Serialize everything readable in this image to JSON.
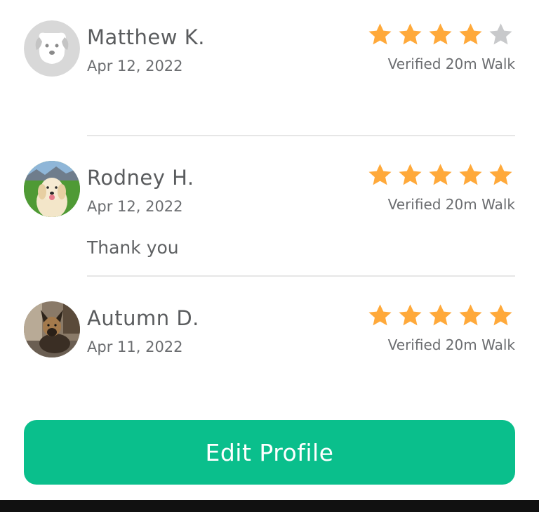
{
  "colors": {
    "star_filled": "#ffa93a",
    "star_empty": "#c8c9cb",
    "accent": "#0abf8c"
  },
  "reviews": [
    {
      "name": "Matthew K.",
      "date": "Apr 12, 2022",
      "rating": 4,
      "verified": "Verified 20m Walk",
      "comment": "",
      "avatar": "dog-placeholder-icon"
    },
    {
      "name": "Rodney H.",
      "date": "Apr 12, 2022",
      "rating": 5,
      "verified": "Verified 20m Walk",
      "comment": "Thank you",
      "avatar": "golden-retriever-photo"
    },
    {
      "name": "Autumn D.",
      "date": "Apr 11, 2022",
      "rating": 5,
      "verified": "Verified 20m Walk",
      "comment": "",
      "avatar": "shepherd-dog-photo"
    }
  ],
  "actions": {
    "edit_profile": "Edit Profile"
  }
}
